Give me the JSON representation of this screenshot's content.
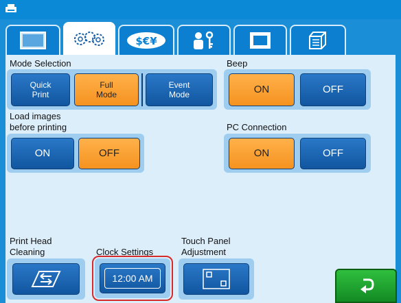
{
  "topbar": {
    "home_icon": "printer-icon"
  },
  "tabs": [
    {
      "icon": "screen-icon",
      "active": false
    },
    {
      "icon": "gears-icon",
      "active": true
    },
    {
      "icon": "currency-icon",
      "active": false
    },
    {
      "icon": "user-key-icon",
      "active": false
    },
    {
      "icon": "frame-icon",
      "active": false
    },
    {
      "icon": "cube-icon",
      "active": false
    }
  ],
  "mode_selection": {
    "label": "Mode Selection",
    "quick_print": "Quick\nPrint",
    "full_mode": "Full\nMode",
    "event_mode": "Event\nMode",
    "selected": "Full Mode"
  },
  "beep": {
    "label": "Beep",
    "on": "ON",
    "off": "OFF",
    "selected": "ON"
  },
  "load_images": {
    "label_line1": "Load images",
    "label_line2": "before printing",
    "on": "ON",
    "off": "OFF",
    "selected": "OFF"
  },
  "pc_connection": {
    "label": "PC Connection",
    "on": "ON",
    "off": "OFF",
    "selected": "ON"
  },
  "print_head": {
    "label_line1": "Print Head",
    "label_line2": "Cleaning",
    "icon": "cleaning-icon"
  },
  "clock": {
    "label": "Clock Settings",
    "time": "12:00 AM"
  },
  "touch_panel": {
    "label_line1": "Touch Panel",
    "label_line2": "Adjustment",
    "icon": "calibration-icon"
  },
  "return": {
    "icon": "return-arrow-icon"
  },
  "colors": {
    "accent_orange": "#f59220",
    "button_blue": "#11569f",
    "panel_bg": "#ddeefb",
    "return_green": "#138a23"
  }
}
